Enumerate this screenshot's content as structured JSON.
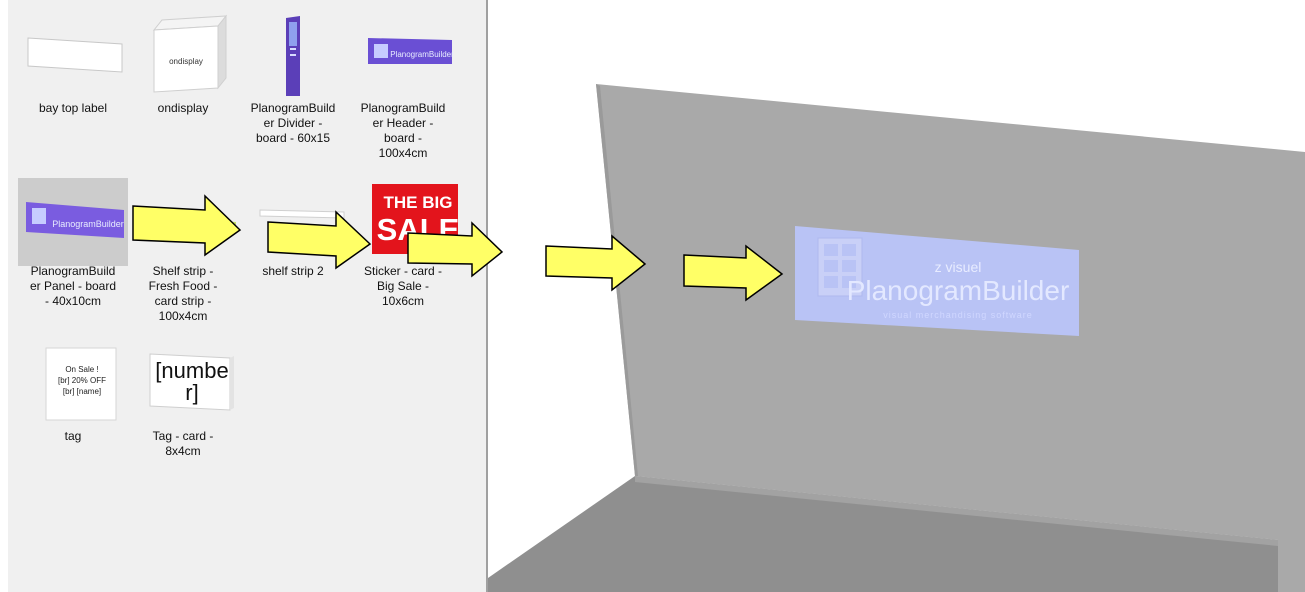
{
  "library": {
    "items": [
      {
        "label": "bay top label"
      },
      {
        "label": "ondisplay",
        "thumb_text": "ondisplay"
      },
      {
        "label": "PlanogramBuild\ner Divider -\nboard - 60x15"
      },
      {
        "label": "PlanogramBuild\ner Header -\nboard -\n100x4cm",
        "thumb_text": "PlanogramBuilder"
      },
      {
        "label": "PlanogramBuild\ner Panel - board\n- 40x10cm",
        "thumb_text": "PlanogramBuilder",
        "selected": true
      },
      {
        "label": "Shelf strip -\nFresh Food -\ncard strip -\n100x4cm"
      },
      {
        "label": "shelf strip 2"
      },
      {
        "label": "Sticker - card -\nBig Sale -\n10x6cm",
        "thumb_line1": "THE BIG",
        "thumb_line2": "SALE"
      },
      {
        "label": "tag",
        "thumb_lines": [
          "On Sale !",
          "[br] 20% OFF",
          "[br] [name]"
        ]
      },
      {
        "label": "Tag - card -\n8x4cm",
        "thumb_text": "[numbe\nr]"
      }
    ]
  },
  "viewport": {
    "panel_brand": "z visuel",
    "panel_title": "PlanogramBuilder",
    "panel_tagline": "visual merchandising software",
    "colors": {
      "wall": "#a9a9a9",
      "floor": "#8f8f8f",
      "panel": "#b9c3f5",
      "arrow_fill": "#ffff66"
    }
  }
}
